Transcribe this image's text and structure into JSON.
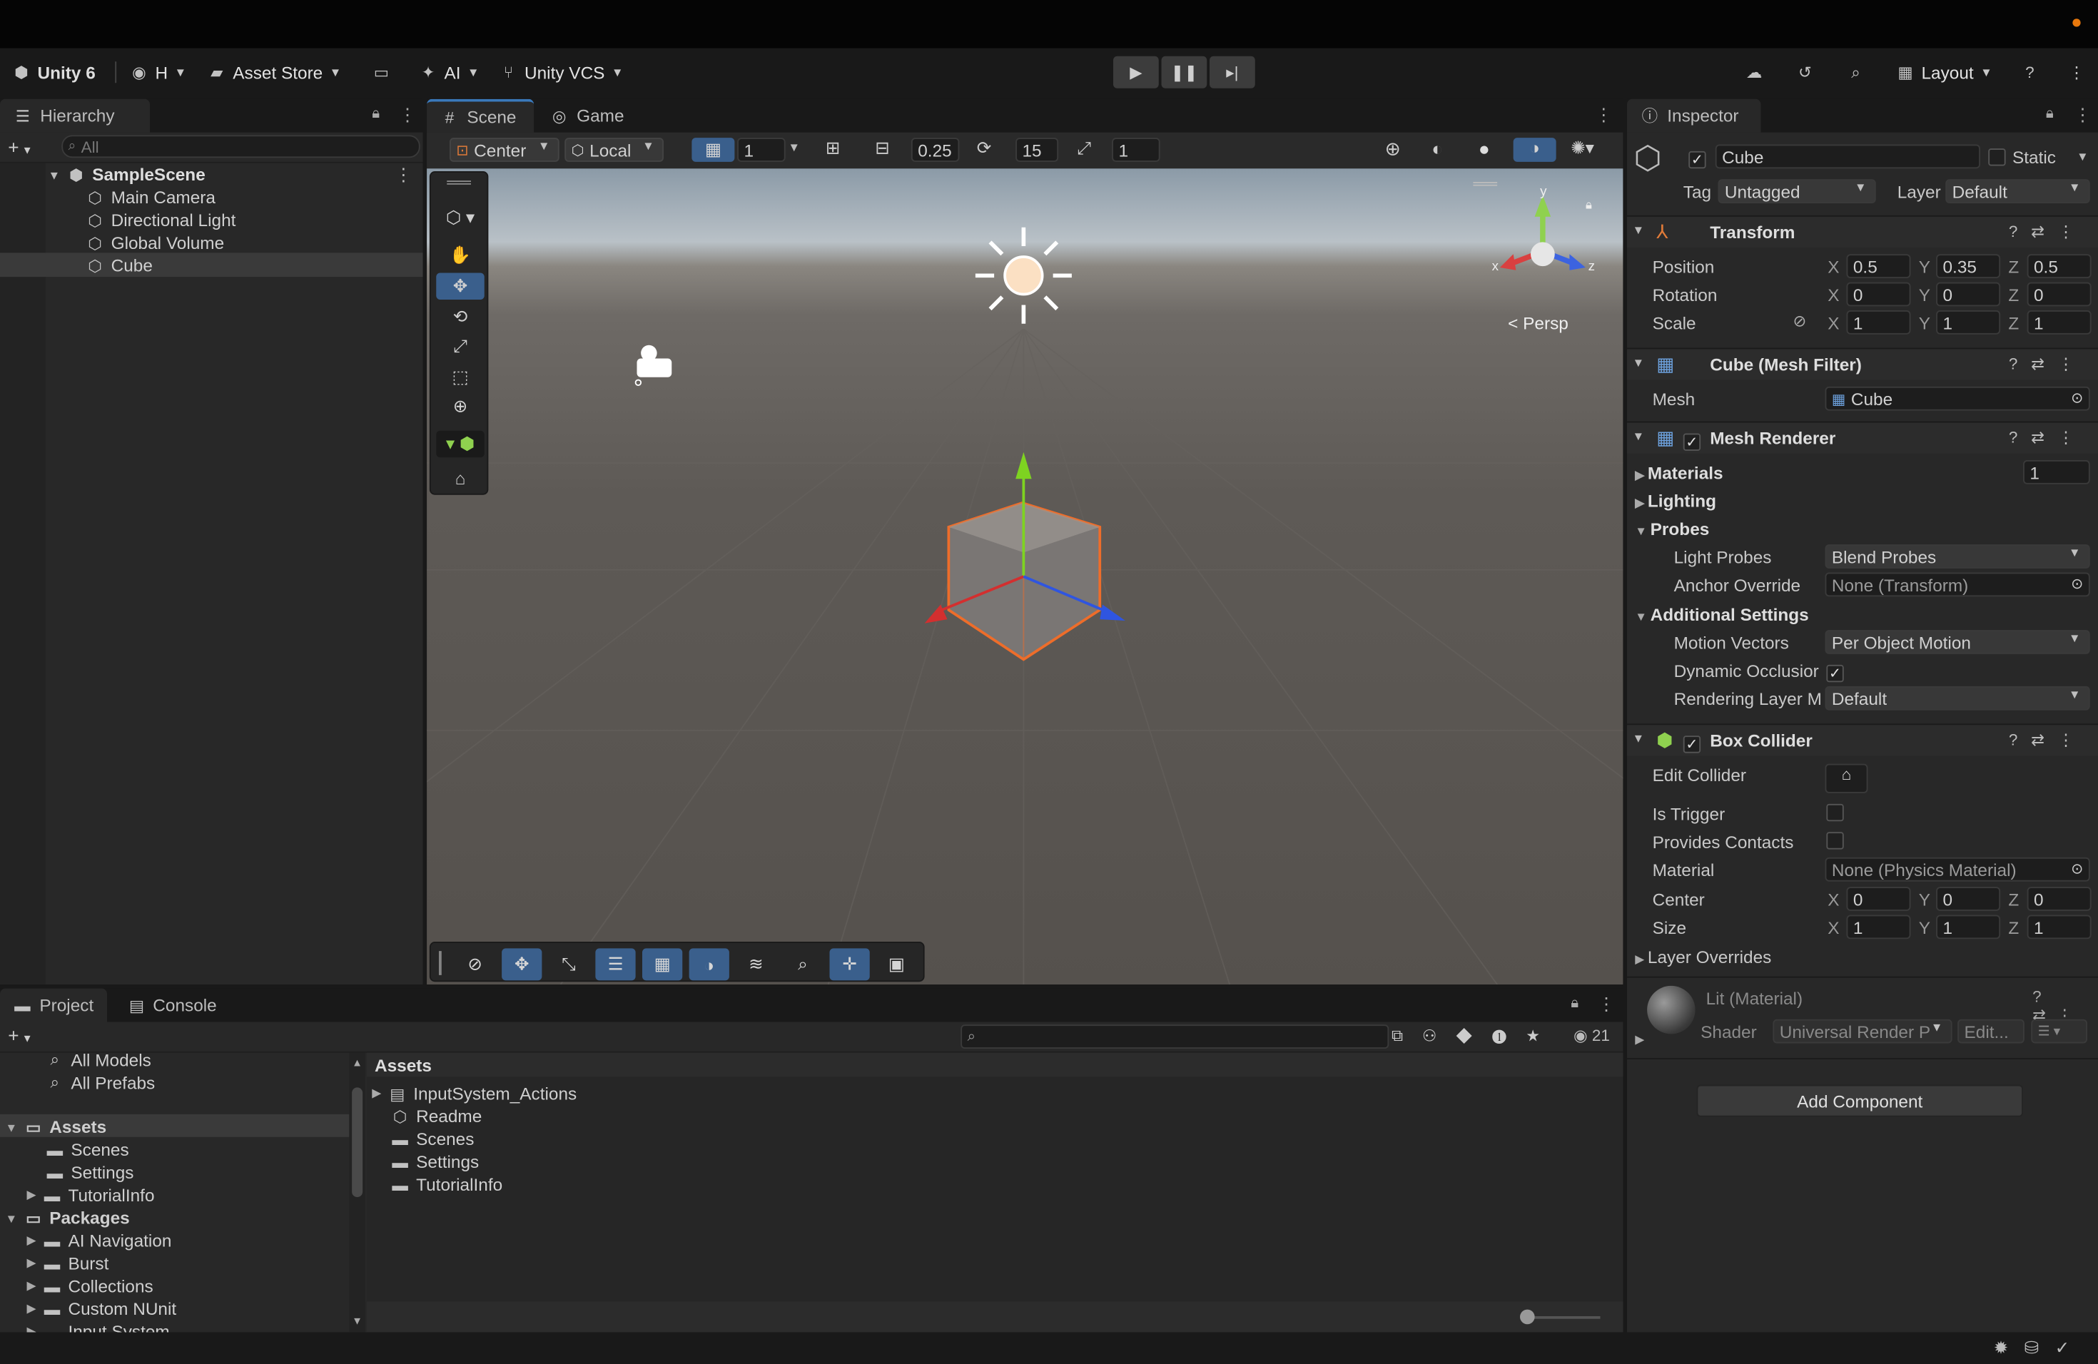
{
  "app": {
    "name": "Unity 6"
  },
  "toolbar": {
    "account": "H",
    "asset_store": "Asset Store",
    "ai": "AI",
    "vcs": "Unity VCS",
    "layout": "Layout"
  },
  "hierarchy": {
    "tab": "Hierarchy",
    "search_placeholder": "All",
    "scene": "SampleScene",
    "items": [
      "Main Camera",
      "Directional Light",
      "Global Volume",
      "Cube"
    ]
  },
  "scene_tabs": {
    "scene": "Scene",
    "game": "Game"
  },
  "scene_toolbar": {
    "pivot": "Center",
    "space": "Local",
    "grid_value": "1",
    "snap_value": "0.25",
    "rotate_snap": "15",
    "scale_snap": "1"
  },
  "scene_view": {
    "persp_label": "Persp",
    "axis_x": "x",
    "axis_y": "y",
    "axis_z": "z"
  },
  "inspector": {
    "tab": "Inspector",
    "object_name": "Cube",
    "static_label": "Static",
    "tag_label": "Tag",
    "tag_value": "Untagged",
    "layer_label": "Layer",
    "layer_value": "Default",
    "transform": {
      "title": "Transform",
      "position_label": "Position",
      "position": {
        "x": "0.5",
        "y": "0.35",
        "z": "0.5"
      },
      "rotation_label": "Rotation",
      "rotation": {
        "x": "0",
        "y": "0",
        "z": "0"
      },
      "scale_label": "Scale",
      "scale": {
        "x": "1",
        "y": "1",
        "z": "1"
      }
    },
    "mesh_filter": {
      "title": "Cube (Mesh Filter)",
      "mesh_label": "Mesh",
      "mesh_value": "Cube"
    },
    "mesh_renderer": {
      "title": "Mesh Renderer",
      "materials_label": "Materials",
      "materials_count": "1",
      "lighting_label": "Lighting",
      "probes_label": "Probes",
      "light_probes_label": "Light Probes",
      "light_probes_value": "Blend Probes",
      "anchor_label": "Anchor Override",
      "anchor_value": "None (Transform)",
      "additional_label": "Additional Settings",
      "motion_label": "Motion Vectors",
      "motion_value": "Per Object Motion",
      "dynamic_label": "Dynamic Occlusior",
      "rendering_label": "Rendering Layer M",
      "rendering_value": "Default"
    },
    "box_collider": {
      "title": "Box Collider",
      "edit_label": "Edit Collider",
      "trigger_label": "Is Trigger",
      "contacts_label": "Provides Contacts",
      "material_label": "Material",
      "material_value": "None (Physics Material)",
      "center_label": "Center",
      "center": {
        "x": "0",
        "y": "0",
        "z": "0"
      },
      "size_label": "Size",
      "size": {
        "x": "1",
        "y": "1",
        "z": "1"
      },
      "overrides_label": "Layer Overrides"
    },
    "material": {
      "title": "Lit (Material)",
      "shader_label": "Shader",
      "shader_value": "Universal Render P",
      "edit_label": "Edit..."
    },
    "add_component": "Add Component",
    "axis": {
      "x": "X",
      "y": "Y",
      "z": "Z"
    }
  },
  "project": {
    "tab_project": "Project",
    "tab_console": "Console",
    "hidden_count": "21",
    "tree": [
      {
        "label": "All Models",
        "kind": "search"
      },
      {
        "label": "All Prefabs",
        "kind": "search"
      },
      {
        "label": "Assets",
        "kind": "root"
      },
      {
        "label": "Scenes",
        "kind": "folder"
      },
      {
        "label": "Settings",
        "kind": "folder"
      },
      {
        "label": "TutorialInfo",
        "kind": "folder-expand"
      },
      {
        "label": "Packages",
        "kind": "root"
      },
      {
        "label": "AI Navigation",
        "kind": "folder-expand"
      },
      {
        "label": "Burst",
        "kind": "folder-expand"
      },
      {
        "label": "Collections",
        "kind": "folder-expand"
      },
      {
        "label": "Custom NUnit",
        "kind": "folder-expand"
      },
      {
        "label": "Input System",
        "kind": "folder-expand"
      }
    ],
    "breadcrumb": "Assets",
    "files": [
      "InputSystem_Actions",
      "Readme",
      "Scenes",
      "Settings",
      "TutorialInfo"
    ]
  }
}
